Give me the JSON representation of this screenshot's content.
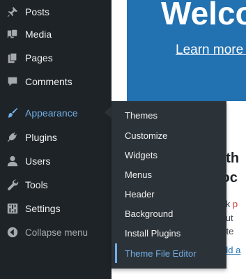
{
  "sidebar": {
    "items": [
      {
        "label": "Posts",
        "icon": "pin-icon"
      },
      {
        "label": "Media",
        "icon": "media-icon"
      },
      {
        "label": "Pages",
        "icon": "pages-icon"
      },
      {
        "label": "Comments",
        "icon": "comment-icon"
      },
      {
        "label": "Appearance",
        "icon": "brush-icon",
        "active": true
      },
      {
        "label": "Plugins",
        "icon": "plug-icon"
      },
      {
        "label": "Users",
        "icon": "user-icon"
      },
      {
        "label": "Tools",
        "icon": "wrench-icon"
      },
      {
        "label": "Settings",
        "icon": "sliders-icon"
      }
    ],
    "collapse_label": "Collapse menu"
  },
  "appearance_submenu": {
    "items": [
      {
        "label": "Themes"
      },
      {
        "label": "Customize"
      },
      {
        "label": "Widgets"
      },
      {
        "label": "Menus"
      },
      {
        "label": "Header"
      },
      {
        "label": "Background"
      },
      {
        "label": "Install Plugins"
      },
      {
        "label": "Theme File Editor",
        "focused": true
      }
    ]
  },
  "welcome_panel": {
    "title": "Welco",
    "link_text": "Learn more ab"
  },
  "author_section": {
    "heading_line1": "uth",
    "heading_line2": "loc",
    "text_line1": "ock",
    "text_line1_accent": "p",
    "text_line2": "yout",
    "text_line3": "eate",
    "link_text": "dd a"
  },
  "colors": {
    "sidebar_bg": "#1d2327",
    "submenu_bg": "#2c3338",
    "accent": "#72aee6",
    "welcome_bg": "#2271b1"
  }
}
